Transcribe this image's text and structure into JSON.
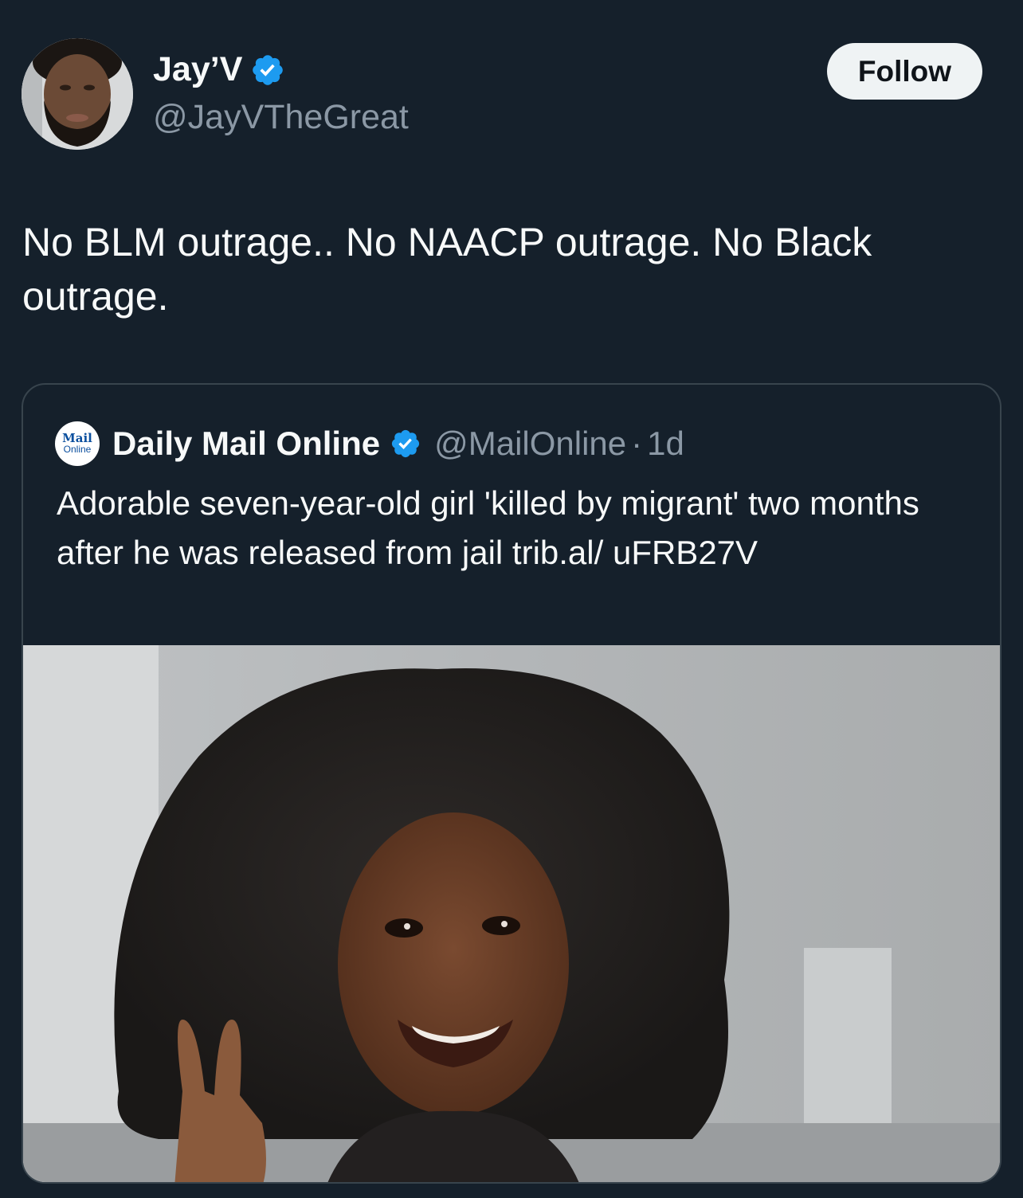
{
  "author": {
    "display_name": "Jay’V",
    "handle": "@JayVTheGreat",
    "verified_icon": "verified-badge-icon"
  },
  "follow_button": {
    "label": "Follow"
  },
  "tweet": {
    "text": "No BLM outrage.. No NAACP outrage. No Black outrage."
  },
  "quote": {
    "logo": {
      "line1": "Mail",
      "line2": "Online"
    },
    "display_name": "Daily Mail Online",
    "handle": "@MailOnline",
    "separator": "·",
    "time": "1d",
    "text": "Adorable seven-year-old girl 'killed by migrant' two months after he was released from jail trib.al/ uFRB27V"
  },
  "colors": {
    "background": "#15202b",
    "verified_blue": "#1d9bf0",
    "secondary_text": "#8b98a5",
    "border": "#38444d"
  }
}
